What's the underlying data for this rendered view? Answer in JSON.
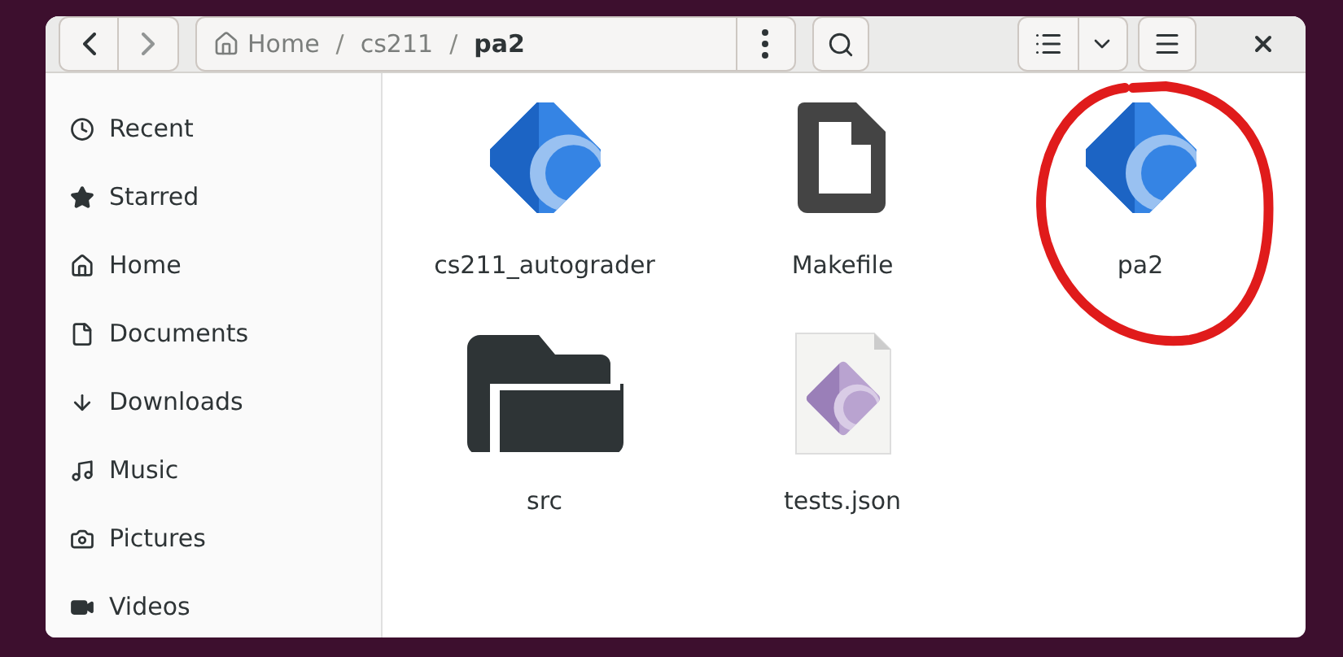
{
  "path": [
    {
      "label": "Home",
      "kind": "home",
      "current": false
    },
    {
      "label": "/",
      "kind": "separator"
    },
    {
      "label": "cs211",
      "kind": "folder",
      "current": false
    },
    {
      "label": "/",
      "kind": "separator"
    },
    {
      "label": "pa2",
      "kind": "folder",
      "current": true
    }
  ],
  "sidebar": {
    "items": [
      {
        "label": "Recent"
      },
      {
        "label": "Starred"
      },
      {
        "label": "Home"
      },
      {
        "label": "Documents"
      },
      {
        "label": "Downloads"
      },
      {
        "label": "Music"
      },
      {
        "label": "Pictures"
      },
      {
        "label": "Videos"
      }
    ]
  },
  "files": [
    {
      "name": "cs211_autograder",
      "kind": "executable",
      "circled": false
    },
    {
      "name": "Makefile",
      "kind": "text",
      "circled": false
    },
    {
      "name": "pa2",
      "kind": "executable",
      "circled": true
    },
    {
      "name": "src",
      "kind": "folder",
      "circled": false
    },
    {
      "name": "tests.json",
      "kind": "json",
      "circled": false
    }
  ]
}
